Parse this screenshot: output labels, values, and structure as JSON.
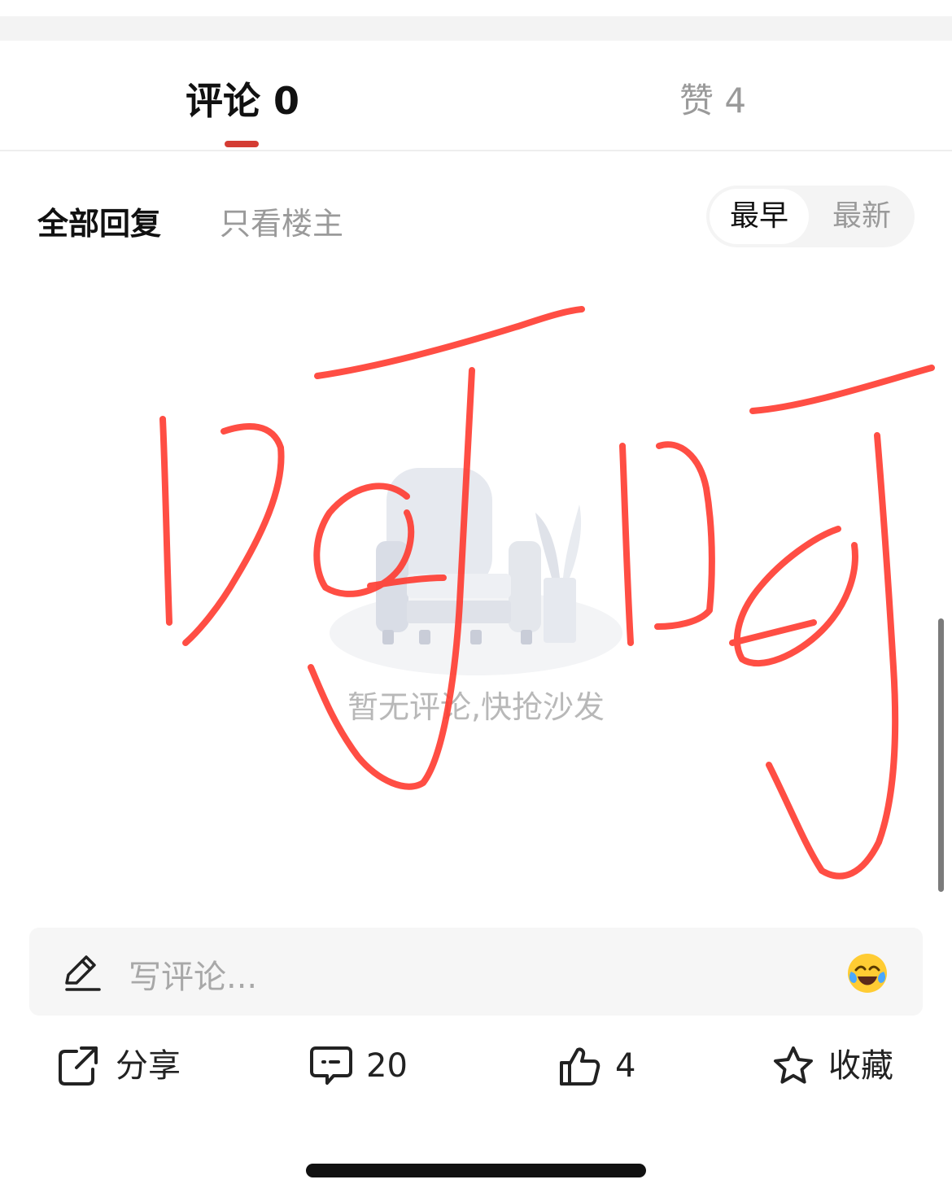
{
  "tabs": {
    "comments_label": "评论 0",
    "likes_label": "赞 4",
    "accent_color": "#d43c33"
  },
  "filters": {
    "all_replies": "全部回复",
    "op_only": "只看楼主",
    "sort_earliest": "最早",
    "sort_latest": "最新"
  },
  "empty_state": {
    "message": "暂无评论,快抢沙发",
    "illustration_icon": "armchair-icon"
  },
  "overlay": {
    "description_icon": "hand-drawn-scribble",
    "color": "#ff3b30"
  },
  "comment_input": {
    "placeholder": "写评论...",
    "left_icon": "pencil-icon",
    "right_icon": "laughing-emoji-icon"
  },
  "actions": {
    "share_label": "分享",
    "comment_count": "20",
    "like_count": "4",
    "favorite_label": "收藏"
  }
}
